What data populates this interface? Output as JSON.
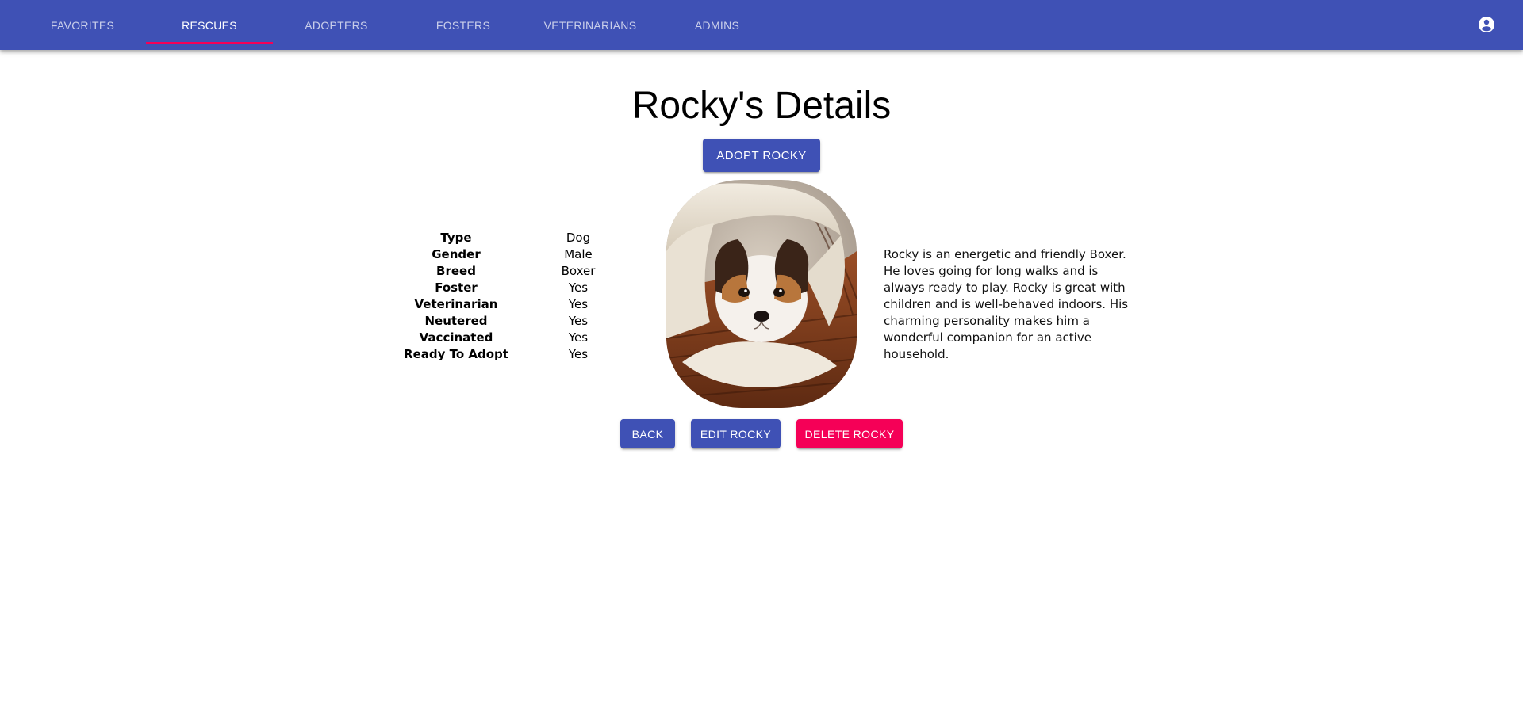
{
  "nav": {
    "tabs": [
      {
        "label": "FAVORITES",
        "active": false
      },
      {
        "label": "RESCUES",
        "active": true
      },
      {
        "label": "ADOPTERS",
        "active": false
      },
      {
        "label": "FOSTERS",
        "active": false
      },
      {
        "label": "VETERINARIANS",
        "active": false
      },
      {
        "label": "ADMINS",
        "active": false
      }
    ],
    "account_icon": "account-circle-icon"
  },
  "page": {
    "title": "Rocky's Details",
    "adopt_label": "ADOPT ROCKY",
    "back_label": "BACK",
    "edit_label": "EDIT ROCKY",
    "delete_label": "DELETE ROCKY"
  },
  "details": [
    {
      "label": "Type",
      "value": "Dog"
    },
    {
      "label": "Gender",
      "value": "Male"
    },
    {
      "label": "Breed",
      "value": "Boxer"
    },
    {
      "label": "Foster",
      "value": "Yes"
    },
    {
      "label": "Veterinarian",
      "value": "Yes"
    },
    {
      "label": "Neutered",
      "value": "Yes"
    },
    {
      "label": "Vaccinated",
      "value": "Yes"
    },
    {
      "label": "Ready To Adopt",
      "value": "Yes"
    }
  ],
  "description": "Rocky is an energetic and friendly Boxer. He loves going for long walks and is always ready to play. Rocky is great with children and is well-behaved indoors. His charming personality makes him a wonderful companion for an active household.",
  "colors": {
    "primary": "#3f51b5",
    "accent": "#f50057"
  }
}
